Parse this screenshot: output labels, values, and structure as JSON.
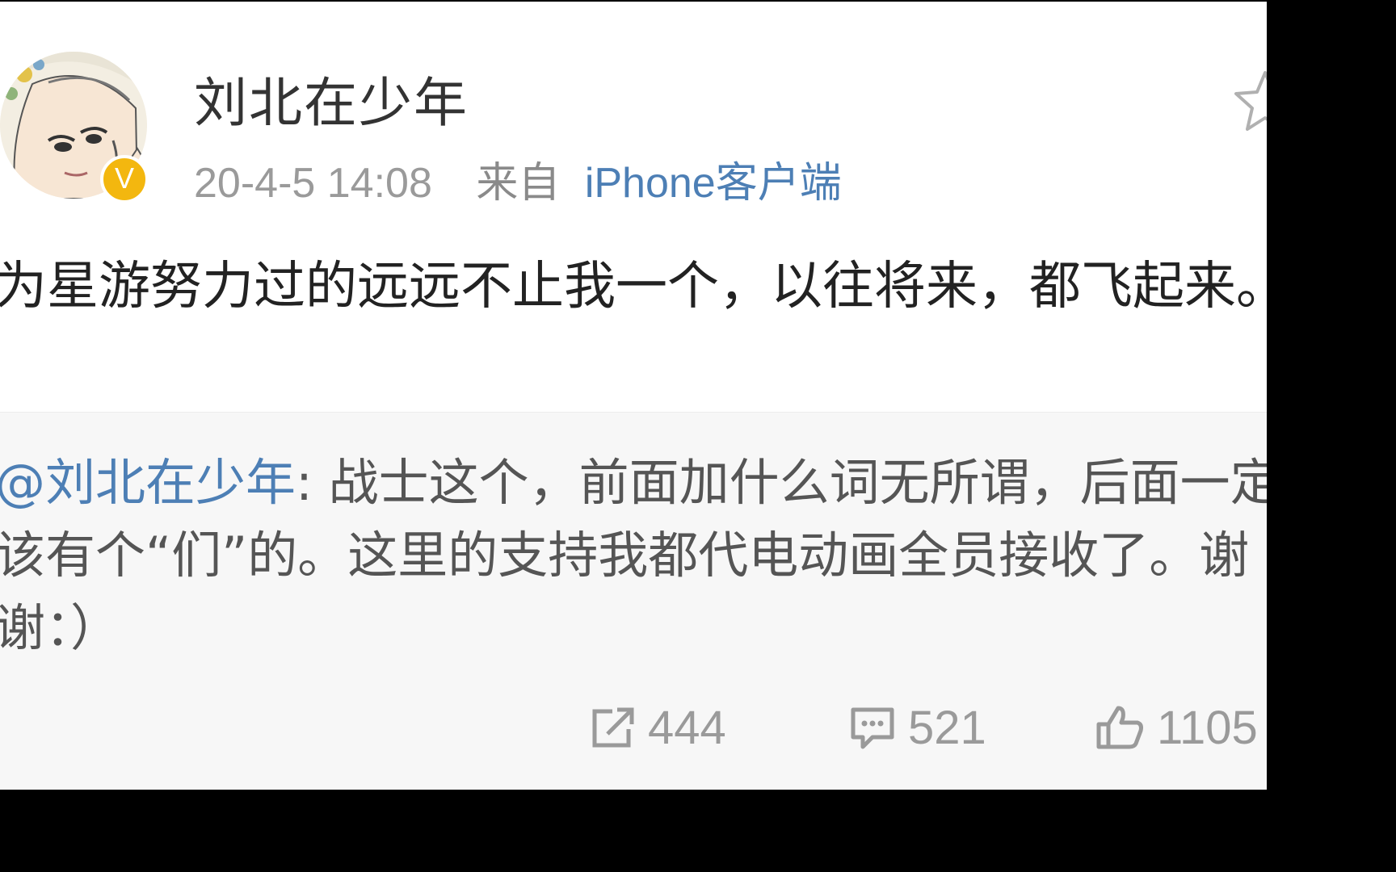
{
  "user": {
    "name": "刘北在少年",
    "verified_badge": "V",
    "avatar_icon": "cartoon-avatar-icon"
  },
  "post": {
    "time": "20-4-5 14:08",
    "from_label": "来自",
    "source": "iPhone客户端",
    "text": "为星游努力过的远远不止我一个，以往将来，都飞起来。"
  },
  "repost": {
    "mention": "@刘北在少年",
    "colon": ":",
    "text": " 战士这个，前面加什么词无所谓，后面一定该有个“们”的。这里的支持我都代电动画全员接收了。谢谢：）"
  },
  "actions": {
    "repost_count": "444",
    "comment_count": "521",
    "like_count": "1105"
  },
  "colors": {
    "link_blue": "#4d7fb5",
    "badge_gold": "#f3b70f",
    "muted_gray": "#9a9a9a",
    "repost_bg": "#f7f7f7"
  }
}
